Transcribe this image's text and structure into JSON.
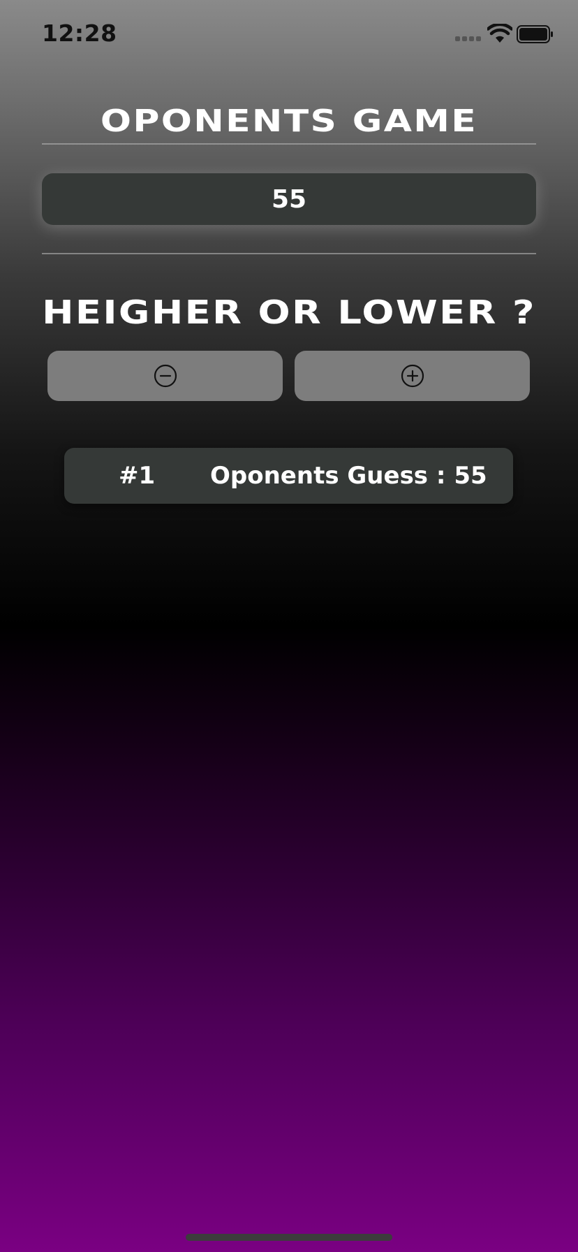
{
  "status_bar": {
    "time": "12:28"
  },
  "header": {
    "title": "OPONENTS GAME"
  },
  "current_guess": {
    "value": "55"
  },
  "prompt": {
    "title": "HEIGHER OR LOWER ?"
  },
  "controls": {
    "lower_icon": "minus-circle-icon",
    "higher_icon": "plus-circle-icon"
  },
  "guess_log": {
    "items": [
      {
        "round": "#1",
        "text": "Oponents Guess : 55"
      }
    ]
  },
  "colors": {
    "gradient_top": "#8a8a8a",
    "gradient_mid": "#000000",
    "gradient_bottom": "#7a0082",
    "card_background": "#353937",
    "button_background": "#7d7d7d",
    "text": "#ffffff"
  }
}
